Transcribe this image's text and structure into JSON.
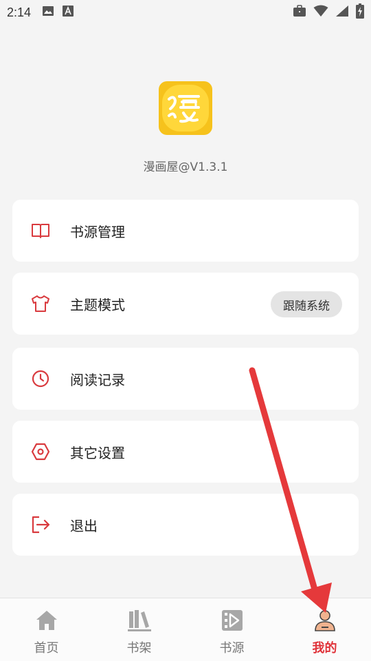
{
  "status_bar": {
    "time": "2:14",
    "icons": [
      "image-icon",
      "a-notification-icon",
      "briefcase-icon",
      "wifi-icon",
      "signal-icon",
      "battery-icon"
    ]
  },
  "app": {
    "logo_icon": "comic-logo-icon",
    "version": "漫画屋@V1.3.1"
  },
  "menu": [
    {
      "label": "书源管理",
      "icon": "book-icon"
    },
    {
      "label": "主题模式",
      "icon": "shirt-icon",
      "badge": "跟随系统"
    },
    {
      "label": "阅读记录",
      "icon": "clock-icon"
    },
    {
      "label": "其它设置",
      "icon": "settings-hexagon-icon"
    },
    {
      "label": "退出",
      "icon": "logout-icon"
    }
  ],
  "nav": {
    "items": [
      {
        "label": "首页",
        "icon": "home-icon"
      },
      {
        "label": "书架",
        "icon": "bookshelf-icon"
      },
      {
        "label": "书源",
        "icon": "source-icon"
      },
      {
        "label": "我的",
        "icon": "profile-icon"
      }
    ],
    "active_index": 3
  },
  "colors": {
    "accent": "#e0333a",
    "background": "#f4f4f4",
    "card": "#ffffff",
    "logo": "#f6c21c",
    "annotation_arrow": "#e5393b"
  }
}
